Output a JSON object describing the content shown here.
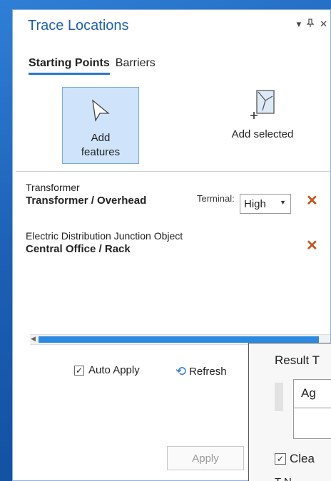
{
  "pane": {
    "title": "Trace Locations",
    "icons": [
      "dropdown-icon",
      "pin-icon",
      "close-icon"
    ]
  },
  "tabs": [
    {
      "label": "Starting Points",
      "active": true
    },
    {
      "label": "Barriers",
      "active": false
    }
  ],
  "toolbar": {
    "add_features_label": "Add features",
    "add_selected_label": "Add selected"
  },
  "list": {
    "items": [
      {
        "class": "Transformer",
        "name": "Transformer / Overhead",
        "terminal_label": "Terminal:",
        "terminal_value": "High"
      },
      {
        "class": "Electric Distribution Junction Object",
        "name": "Central Office / Rack"
      }
    ]
  },
  "footer": {
    "auto_apply_label": "Auto Apply",
    "auto_apply_checked": true,
    "refresh_label": "Refresh",
    "apply_label": "Apply"
  },
  "overlay": {
    "heading": "Result T",
    "combo_value": "Ag",
    "clear_label": "Clea",
    "clear_checked": true,
    "footer_text": "T    N"
  },
  "colors": {
    "accent": "#2b78d0",
    "title": "#1f5fb0",
    "remove": "#c9541e",
    "selected_bg": "#cfe4fb"
  }
}
